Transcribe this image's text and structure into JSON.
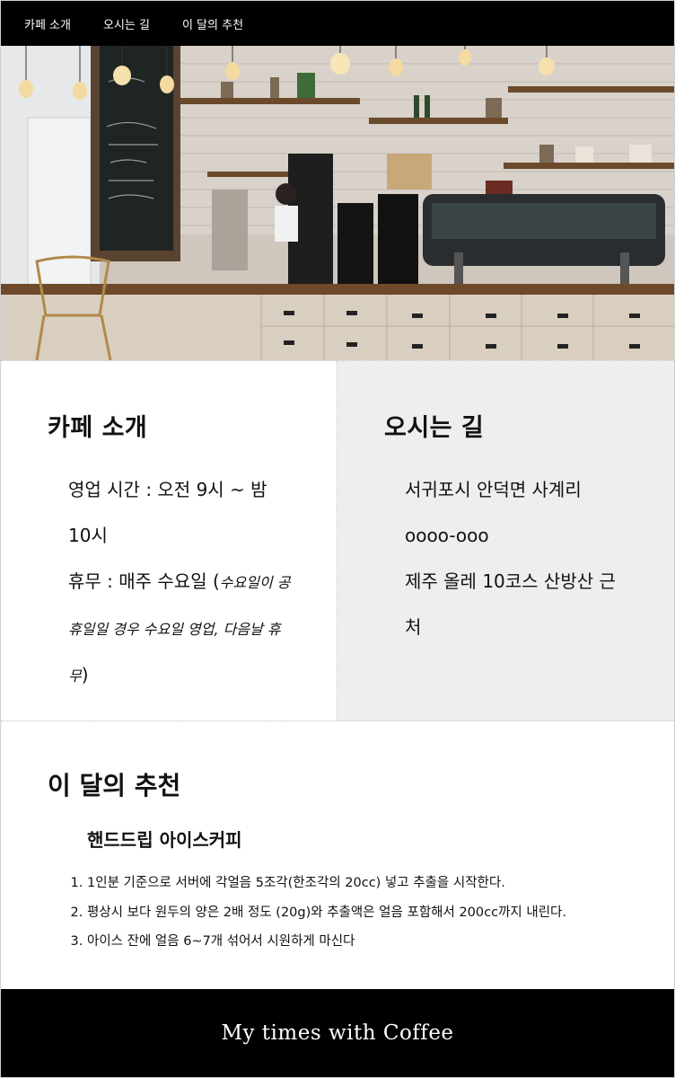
{
  "nav": {
    "items": [
      {
        "label": "카페 소개"
      },
      {
        "label": "오시는 길"
      },
      {
        "label": "이 달의 추천"
      }
    ]
  },
  "hero": {
    "icon": "cafe-interior-photo"
  },
  "about": {
    "title": "카페 소개",
    "hours": "영업 시간 : 오전 9시 ~ 밤 10시",
    "holiday": "휴무 : 매주 수요일 (",
    "holiday_note": "수요일이 공휴일일 경우 수요일 영업, 다음날 휴무",
    "holiday_end": ")"
  },
  "directions": {
    "title": "오시는 길",
    "address": "서귀포시 안덕면 사계리 oooo-ooo",
    "landmark": "제주 올레 10코스 산방산 근처"
  },
  "recommend": {
    "title": "이 달의 추천",
    "menu_name": "핸드드립 아이스커피",
    "steps": [
      "1인분 기준으로 서버에 각얼음 5조각(한조각의 20cc) 넣고 추출을 시작한다.",
      "평상시 보다 원두의 양은 2배 정도 (20g)와 추출액은 얼음 포함해서 200cc까지 내린다.",
      "아이스 잔에 얼음 6~7개 섞어서 시원하게 마신다"
    ]
  },
  "footer": {
    "text": "My times with Coffee"
  }
}
